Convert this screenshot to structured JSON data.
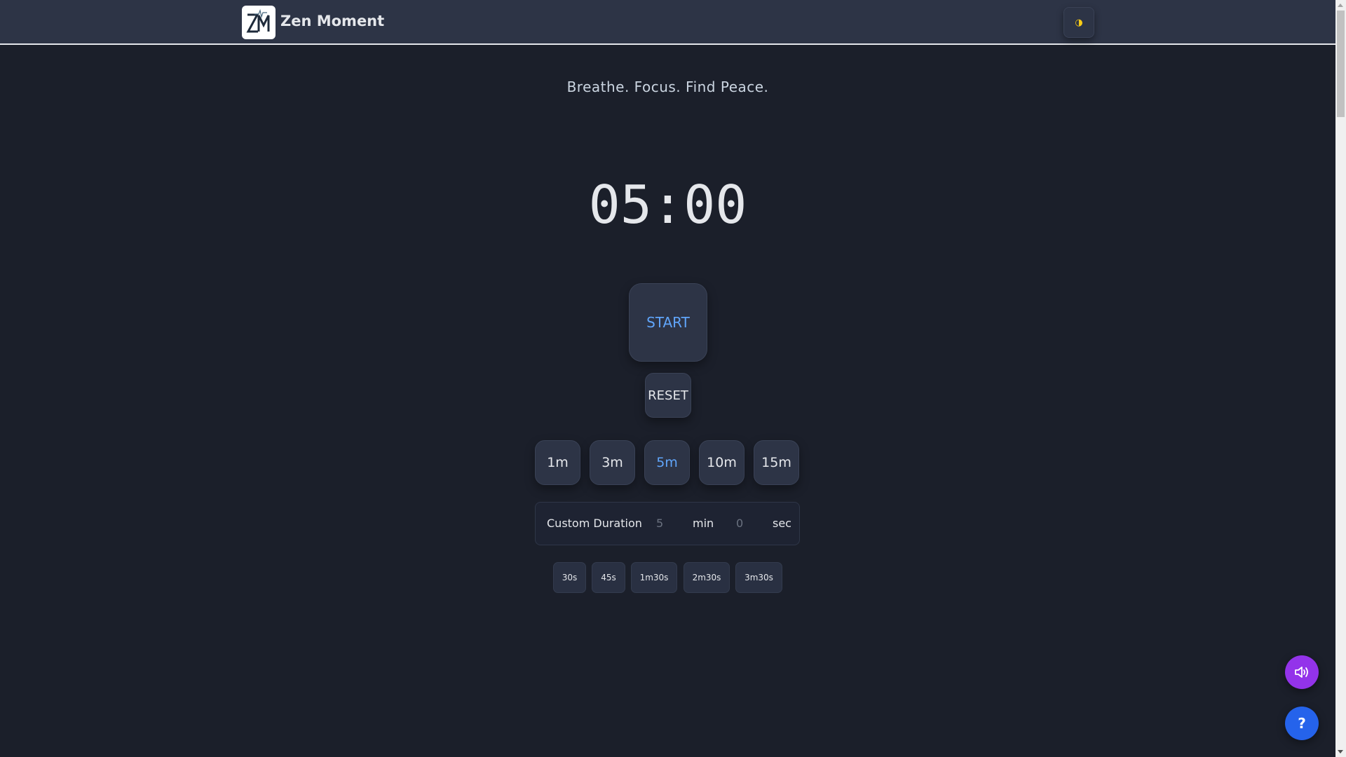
{
  "header": {
    "title": "Zen Moment",
    "logo_text": "ZM",
    "theme_icon": "◑"
  },
  "tagline": "Breathe. Focus. Find Peace.",
  "timer": {
    "display": "05:00"
  },
  "controls": {
    "start_label": "START",
    "reset_label": "RESET"
  },
  "presets": [
    {
      "label": "1m"
    },
    {
      "label": "3m"
    },
    {
      "label": "5m",
      "active": true
    },
    {
      "label": "10m"
    },
    {
      "label": "15m"
    }
  ],
  "custom": {
    "label": "Custom Duration",
    "minutes": "5",
    "min_unit": "min",
    "seconds": "0",
    "sec_unit": "sec"
  },
  "quick_presets": [
    {
      "label": "30s"
    },
    {
      "label": "45s"
    },
    {
      "label": "1m30s"
    },
    {
      "label": "2m30s"
    },
    {
      "label": "3m30s"
    }
  ],
  "fab": {
    "help_label": "?"
  },
  "colors": {
    "accent": "#60a5fa",
    "sound": "#9333ea",
    "help": "#2563eb",
    "theme_icon": "#facc15"
  }
}
